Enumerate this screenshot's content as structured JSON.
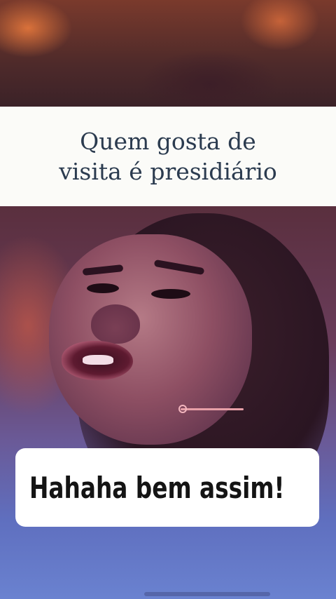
{
  "caption": {
    "text": "Quem gosta de\nvisita é presidiário"
  },
  "speech": {
    "text": "Hahaha bem assim!"
  },
  "colors": {
    "caption_background": "#fbfbf8",
    "caption_text": "#2b3b4f",
    "speech_background": "#ffffff",
    "speech_text": "#141414"
  }
}
